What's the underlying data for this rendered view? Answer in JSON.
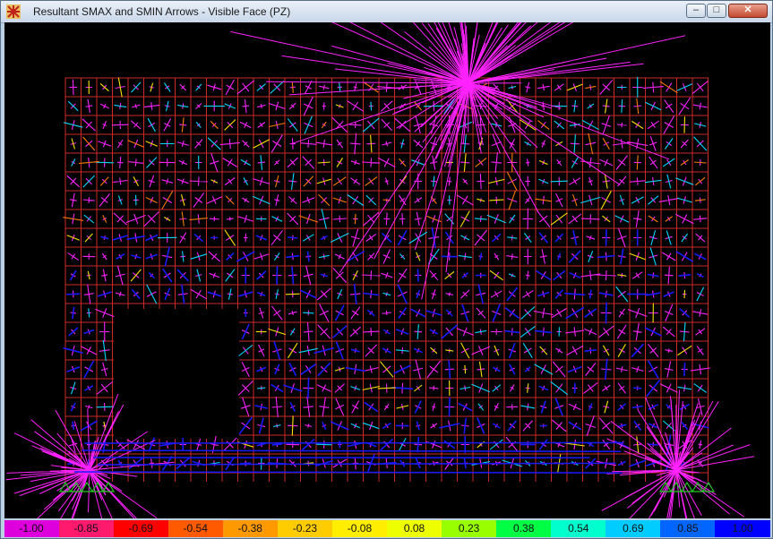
{
  "window": {
    "title": "Resultant SMAX and SMIN Arrows - Visible Face   (PZ)",
    "buttons": {
      "minimize": "–",
      "maximize": "□",
      "close": "✕"
    }
  },
  "view": {
    "background": "#000000",
    "mesh_color": "#cc2a2a",
    "arrow_colors": [
      "#ff22ff",
      "#1a1aff",
      "#00d8ff",
      "#ffe000",
      "#ff7a00",
      "#22ff22"
    ],
    "support_color": "#22cc22"
  },
  "legend": {
    "labels": [
      "-1.00",
      "-0.85",
      "-0.69",
      "-0.54",
      "-0.38",
      "-0.23",
      "-0.08",
      "0.08",
      "0.23",
      "0.38",
      "0.54",
      "0.69",
      "0.85",
      "1.00"
    ],
    "colors": [
      "#dd00dd",
      "#ff1a6e",
      "#ff0000",
      "#ff5a00",
      "#ff9900",
      "#ffcc00",
      "#ffee00",
      "#eeff00",
      "#99ff00",
      "#00ff44",
      "#00ffcc",
      "#00ccff",
      "#0066ff",
      "#0000ff"
    ]
  }
}
